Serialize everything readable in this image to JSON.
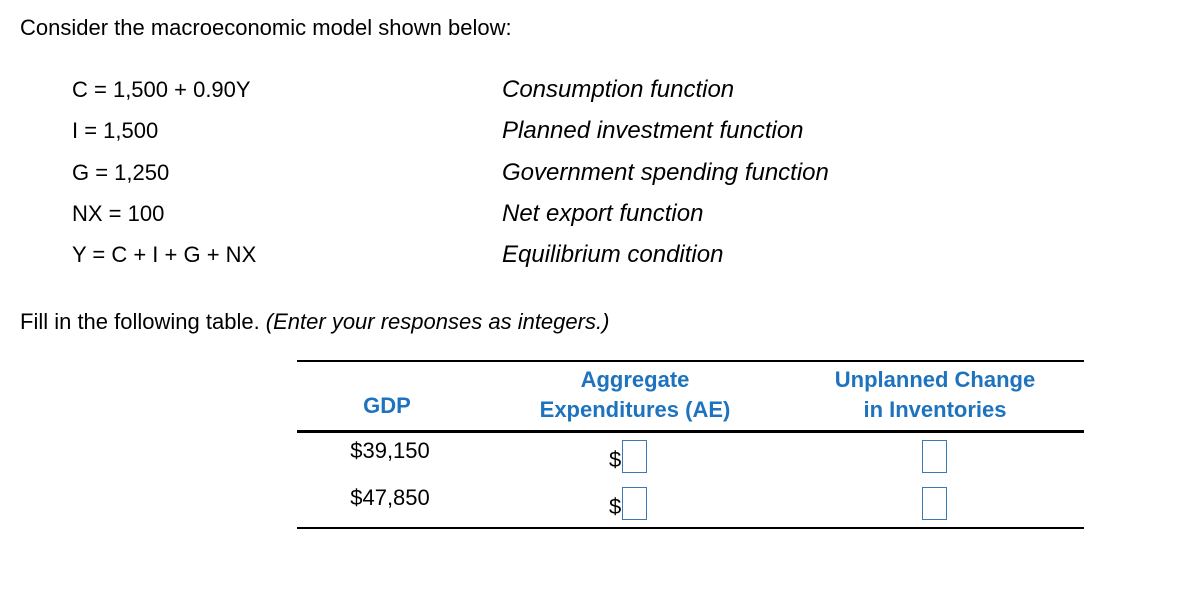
{
  "intro": "Consider the macroeconomic model shown below:",
  "equations": [
    {
      "formula": "C = 1,500 + 0.90Y",
      "description": "Consumption function"
    },
    {
      "formula": "I = 1,500",
      "description": "Planned investment function"
    },
    {
      "formula": "G = 1,250",
      "description": "Government spending function"
    },
    {
      "formula": "NX = 100",
      "description": "Net export function"
    },
    {
      "formula": "Y = C + I + G + NX",
      "description": "Equilibrium condition"
    }
  ],
  "instruction": {
    "text": "Fill in the following table. ",
    "note": "(Enter your responses as integers.)"
  },
  "table": {
    "header_color": "#1e73be",
    "headers": {
      "gdp": "GDP",
      "ae_line1": "Aggregate",
      "ae_line2": "Expenditures (AE)",
      "uci_line1": "Unplanned Change",
      "uci_line2": "in Inventories"
    },
    "rows": [
      {
        "gdp": "$39,150",
        "ae_prefix": "$",
        "ae_value": "",
        "uci_value": ""
      },
      {
        "gdp": "$47,850",
        "ae_prefix": "$",
        "ae_value": "",
        "uci_value": ""
      }
    ]
  }
}
